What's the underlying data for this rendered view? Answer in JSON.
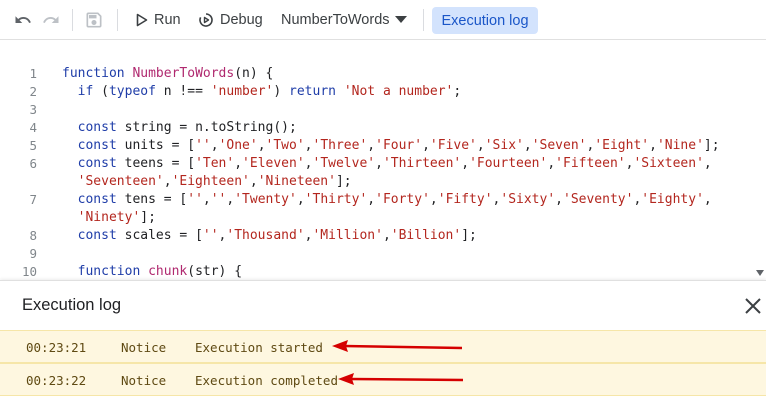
{
  "toolbar": {
    "run_label": "Run",
    "debug_label": "Debug",
    "function_select": "NumberToWords",
    "execution_log_label": "Execution log"
  },
  "editor": {
    "lines": [
      {
        "n": "1",
        "parts": [
          [
            "kw",
            "function "
          ],
          [
            "fn",
            "NumberToWords"
          ],
          [
            "",
            "(n) {"
          ]
        ]
      },
      {
        "n": "2",
        "parts": [
          [
            "",
            "  "
          ],
          [
            "kw",
            "if"
          ],
          [
            "",
            " ("
          ],
          [
            "kw",
            "typeof"
          ],
          [
            "",
            " n !== "
          ],
          [
            "str",
            "'number'"
          ],
          [
            "",
            ") "
          ],
          [
            "kw",
            "return"
          ],
          [
            "",
            " "
          ],
          [
            "str",
            "'Not a number'"
          ],
          [
            "",
            ";"
          ]
        ]
      },
      {
        "n": "3",
        "parts": []
      },
      {
        "n": "4",
        "parts": [
          [
            "",
            "  "
          ],
          [
            "kw",
            "const"
          ],
          [
            "",
            " string = n.toString();"
          ]
        ]
      },
      {
        "n": "5",
        "parts": [
          [
            "",
            "  "
          ],
          [
            "kw",
            "const"
          ],
          [
            "",
            " units = ["
          ],
          [
            "str",
            "''"
          ],
          [
            "",
            ","
          ],
          [
            "str",
            "'One'"
          ],
          [
            "",
            ","
          ],
          [
            "str",
            "'Two'"
          ],
          [
            "",
            ","
          ],
          [
            "str",
            "'Three'"
          ],
          [
            "",
            ","
          ],
          [
            "str",
            "'Four'"
          ],
          [
            "",
            ","
          ],
          [
            "str",
            "'Five'"
          ],
          [
            "",
            ","
          ],
          [
            "str",
            "'Six'"
          ],
          [
            "",
            ","
          ],
          [
            "str",
            "'Seven'"
          ],
          [
            "",
            ","
          ],
          [
            "str",
            "'Eight'"
          ],
          [
            "",
            ","
          ],
          [
            "str",
            "'Nine'"
          ],
          [
            "",
            "];"
          ]
        ]
      },
      {
        "n": "6",
        "parts": [
          [
            "",
            "  "
          ],
          [
            "kw",
            "const"
          ],
          [
            "",
            " teens = ["
          ],
          [
            "str",
            "'Ten'"
          ],
          [
            "",
            ","
          ],
          [
            "str",
            "'Eleven'"
          ],
          [
            "",
            ","
          ],
          [
            "str",
            "'Twelve'"
          ],
          [
            "",
            ","
          ],
          [
            "str",
            "'Thirteen'"
          ],
          [
            "",
            ","
          ],
          [
            "str",
            "'Fourteen'"
          ],
          [
            "",
            ","
          ],
          [
            "str",
            "'Fifteen'"
          ],
          [
            "",
            ","
          ],
          [
            "str",
            "'Sixteen'"
          ],
          [
            "",
            ","
          ]
        ]
      },
      {
        "n": "",
        "parts": [
          [
            "",
            "  "
          ],
          [
            "str",
            "'Seventeen'"
          ],
          [
            "",
            ","
          ],
          [
            "str",
            "'Eighteen'"
          ],
          [
            "",
            ","
          ],
          [
            "str",
            "'Nineteen'"
          ],
          [
            "",
            "];"
          ]
        ]
      },
      {
        "n": "7",
        "parts": [
          [
            "",
            "  "
          ],
          [
            "kw",
            "const"
          ],
          [
            "",
            " tens = ["
          ],
          [
            "str",
            "''"
          ],
          [
            "",
            ","
          ],
          [
            "str",
            "''"
          ],
          [
            "",
            ","
          ],
          [
            "str",
            "'Twenty'"
          ],
          [
            "",
            ","
          ],
          [
            "str",
            "'Thirty'"
          ],
          [
            "",
            ","
          ],
          [
            "str",
            "'Forty'"
          ],
          [
            "",
            ","
          ],
          [
            "str",
            "'Fifty'"
          ],
          [
            "",
            ","
          ],
          [
            "str",
            "'Sixty'"
          ],
          [
            "",
            ","
          ],
          [
            "str",
            "'Seventy'"
          ],
          [
            "",
            ","
          ],
          [
            "str",
            "'Eighty'"
          ],
          [
            "",
            ","
          ]
        ]
      },
      {
        "n": "",
        "parts": [
          [
            "",
            "  "
          ],
          [
            "str",
            "'Ninety'"
          ],
          [
            "",
            "];"
          ]
        ]
      },
      {
        "n": "8",
        "parts": [
          [
            "",
            "  "
          ],
          [
            "kw",
            "const"
          ],
          [
            "",
            " scales = ["
          ],
          [
            "str",
            "''"
          ],
          [
            "",
            ","
          ],
          [
            "str",
            "'Thousand'"
          ],
          [
            "",
            ","
          ],
          [
            "str",
            "'Million'"
          ],
          [
            "",
            ","
          ],
          [
            "str",
            "'Billion'"
          ],
          [
            "",
            "];"
          ]
        ]
      },
      {
        "n": "9",
        "parts": []
      },
      {
        "n": "10",
        "parts": [
          [
            "",
            "  "
          ],
          [
            "kw",
            "function"
          ],
          [
            "",
            " "
          ],
          [
            "fn",
            "chunk"
          ],
          [
            "",
            "(str) {"
          ]
        ]
      }
    ]
  },
  "log": {
    "title": "Execution log",
    "entries": [
      {
        "time": "00:23:21",
        "level": "Notice",
        "message": "Execution started"
      },
      {
        "time": "00:23:22",
        "level": "Notice",
        "message": "Execution completed"
      }
    ]
  },
  "annotation_color": "#d50000"
}
